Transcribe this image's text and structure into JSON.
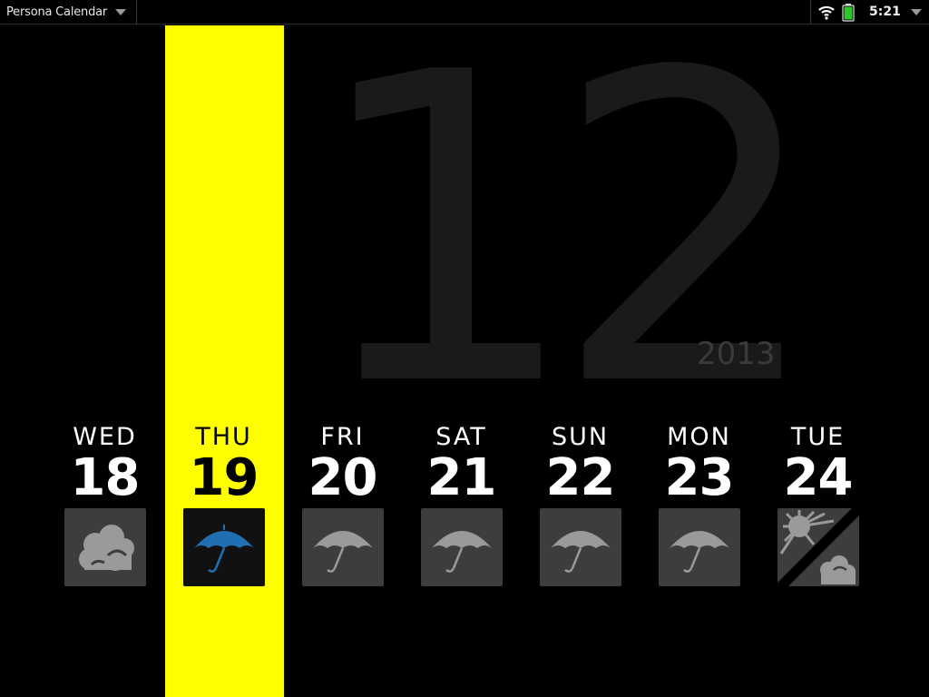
{
  "statusbar": {
    "app_title": "Persona Calendar",
    "time": "5:21",
    "icons": [
      "wifi-icon",
      "battery-icon"
    ],
    "battery_color": "#2ec82e"
  },
  "calendar": {
    "month": "12",
    "year": "2013",
    "today_color": "#ffff00",
    "days": [
      {
        "dow": "WED",
        "num": "18",
        "weather": "cloudy-icon"
      },
      {
        "dow": "THU",
        "num": "19",
        "weather": "rain-umbrella-icon",
        "today": true
      },
      {
        "dow": "FRI",
        "num": "20",
        "weather": "rain-umbrella-icon"
      },
      {
        "dow": "SAT",
        "num": "21",
        "weather": "rain-umbrella-icon"
      },
      {
        "dow": "SUN",
        "num": "22",
        "weather": "rain-umbrella-icon"
      },
      {
        "dow": "MON",
        "num": "23",
        "weather": "rain-umbrella-icon"
      },
      {
        "dow": "TUE",
        "num": "24",
        "weather": "sun-cloud-split-icon"
      }
    ]
  }
}
